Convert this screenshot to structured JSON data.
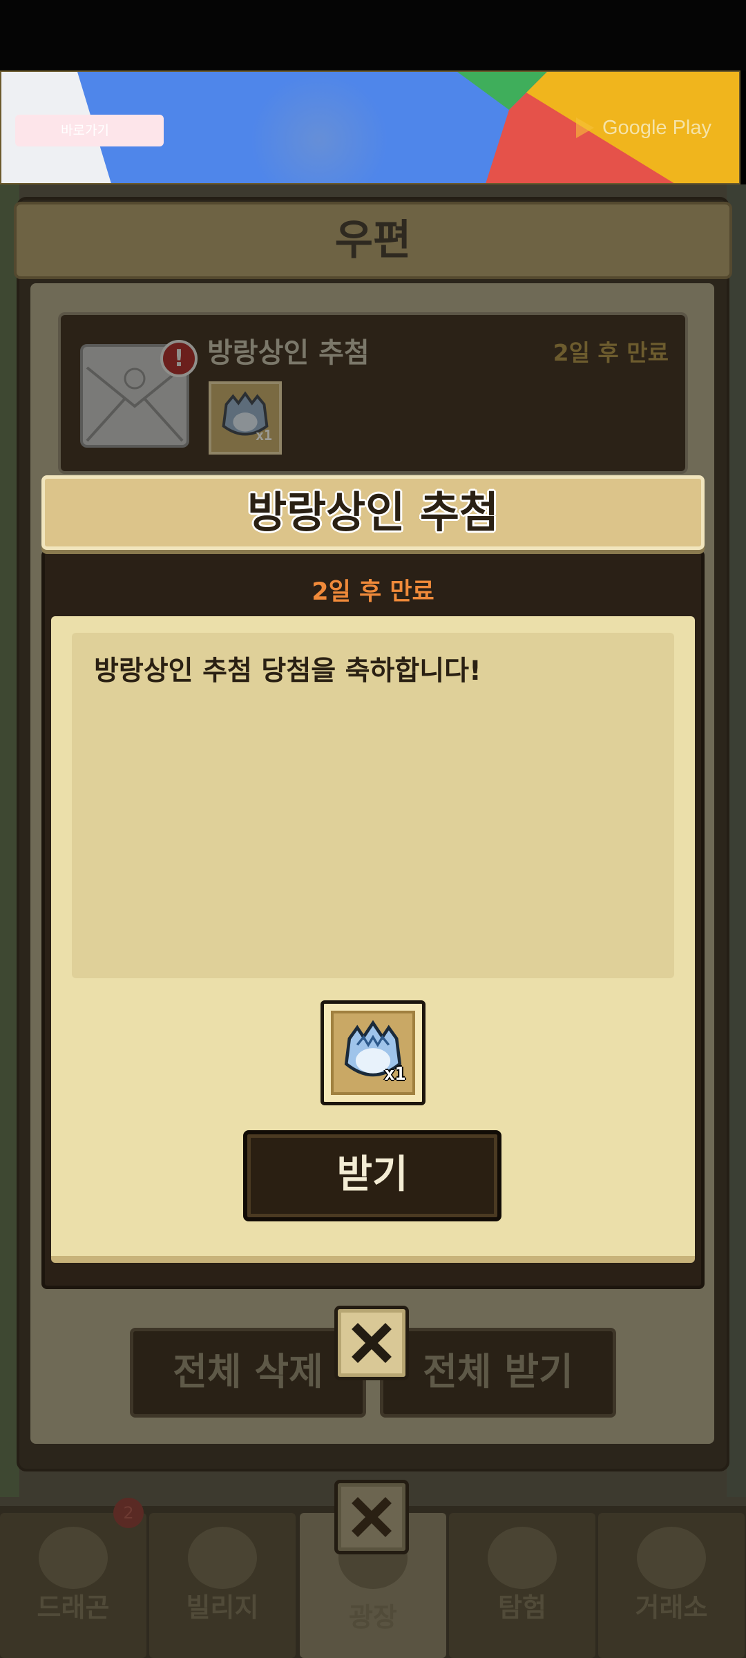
{
  "ad": {
    "button_label": "바로가기",
    "store_label": "Google Play"
  },
  "mailbox": {
    "title": "우편",
    "item": {
      "title": "방랑상인 추첨",
      "expire": "2일 후 만료",
      "reward_qty": "x1"
    },
    "delete_all_label": "전체 삭제",
    "receive_all_label": "전체 받기"
  },
  "dialog": {
    "title": "방랑상인 추첨",
    "expire": "2일 후 만료",
    "message": "방랑상인 추첨 당첨을 축하합니다!",
    "reward_qty": "x1",
    "receive_label": "받기"
  },
  "nav": {
    "tabs": [
      {
        "label": "드래곤"
      },
      {
        "label": "빌리지"
      },
      {
        "label": "광장"
      },
      {
        "label": "탐험"
      },
      {
        "label": "거래소"
      }
    ],
    "dragon_badge": "2"
  },
  "colors": {
    "accent_orange": "#f08a3a",
    "paper": "#ebdfaa",
    "title_bar": "#dcc48a"
  }
}
